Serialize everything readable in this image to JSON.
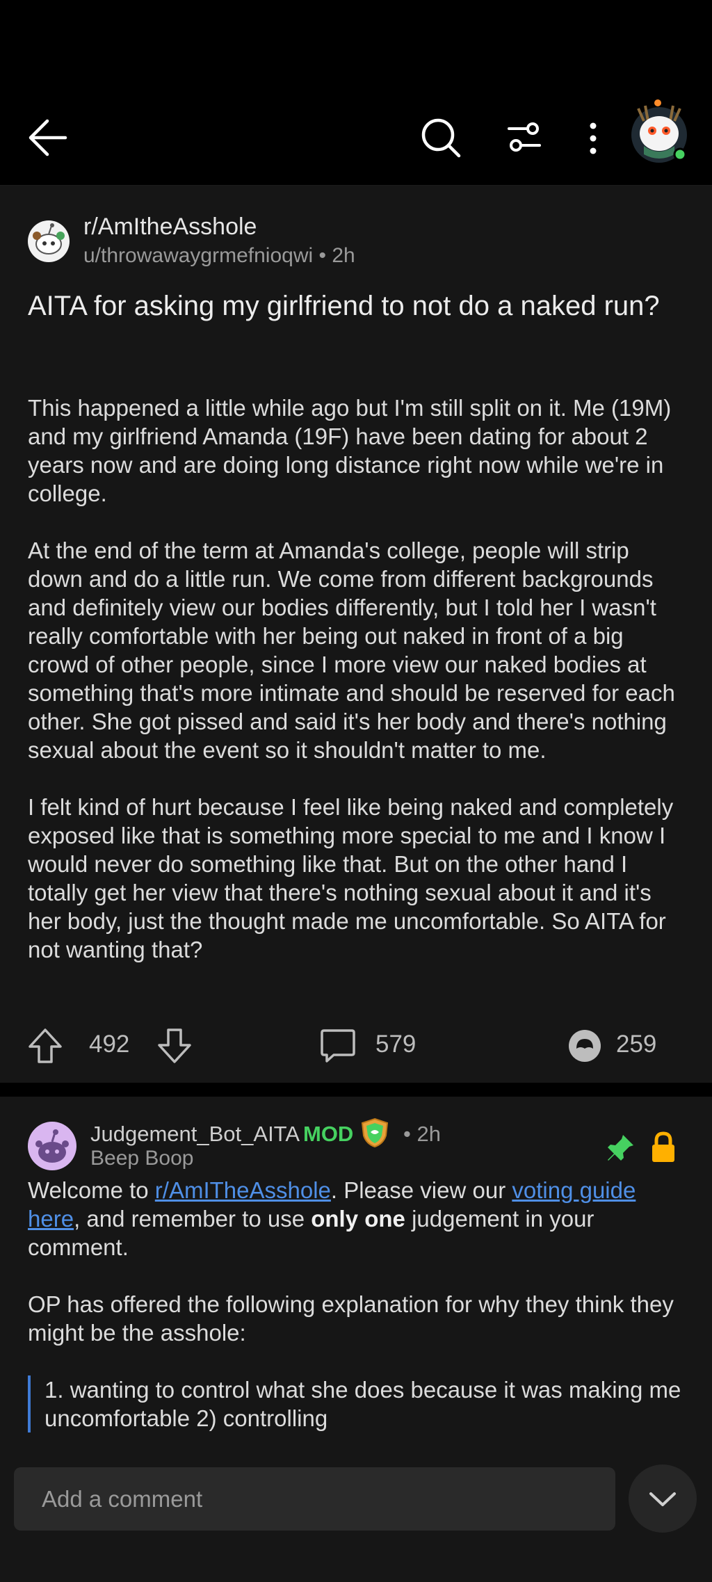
{
  "header": {
    "back_icon": "arrow-left-icon",
    "search_icon": "search-icon",
    "sort_icon": "sliders-icon",
    "more_icon": "more-vertical-icon",
    "avatar_icon": "user-avatar",
    "online_color": "#46d160"
  },
  "post": {
    "subreddit": "r/AmItheAsshole",
    "author": "u/throwawaygrmefnioqwi",
    "separator": "•",
    "time": "2h",
    "title": "AITA for asking my girlfriend to not do a naked run?",
    "body": [
      "This happened a little while ago but I'm still split on it. Me (19M) and my girlfriend Amanda (19F) have been dating for about 2 years now and are doing long distance right now while we're in college.",
      "At the end of the term at Amanda's college, people will strip down and do a little run. We come from different backgrounds and definitely view our bodies differently, but I told her I wasn't really comfortable with her being out naked in front of a big crowd of other people, since I more view our naked bodies at something that's more intimate and should be reserved for each other. She got pissed and said it's her body and there's nothing sexual about the event so it shouldn't matter to me.",
      "I felt kind of hurt because I feel like being naked and completely exposed like that is something more special to me and I know I would never do something like that. But on the other hand I totally get her view that there's nothing sexual about it and it's her body, just the thought made me uncomfortable. So AITA for not wanting that?"
    ],
    "upvotes": "492",
    "comments": "579",
    "awards": "259"
  },
  "comment": {
    "author": "Judgement_Bot_AITA",
    "mod_label": "MOD",
    "separator": "•",
    "time": "2h",
    "flair": "Beep Boop",
    "welcome_prefix": "Welcome to ",
    "sub_link": "r/AmITheAsshole",
    "view_text": ". Please view our ",
    "guide_link": "voting guide here",
    "remember_text": ", and remember to use ",
    "only_one": "only one",
    "judgement_text": " judgement in your comment.",
    "op_text": "OP has offered the following explanation for why they think they might be the asshole:",
    "quote": "1. wanting to control what she does because it was making me uncomfortable 2) controlling",
    "pin_color": "#46d160",
    "lock_color": "#ffb000"
  },
  "composer": {
    "placeholder": "Add a comment"
  }
}
